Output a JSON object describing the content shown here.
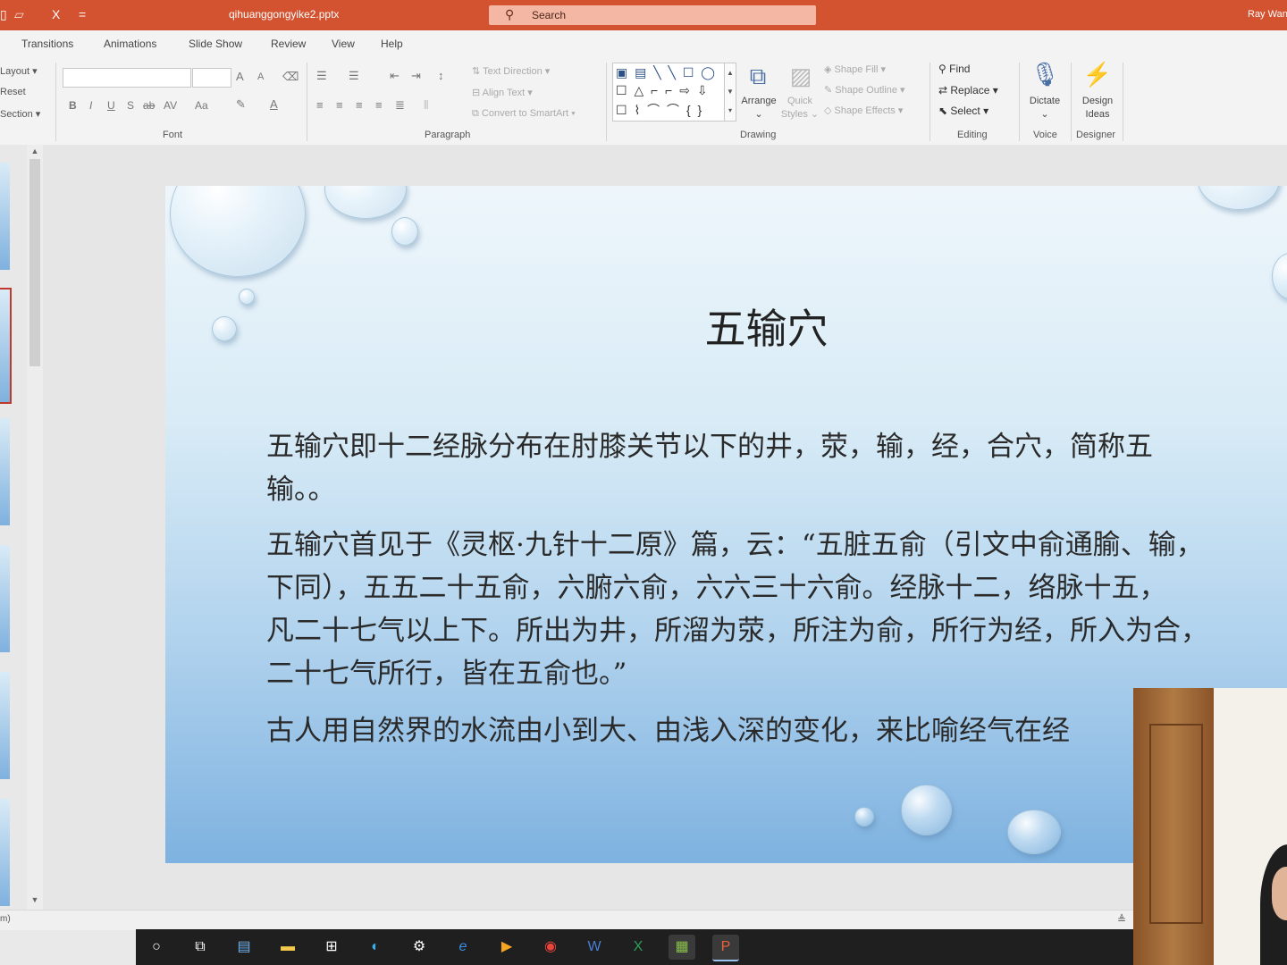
{
  "titlebar": {
    "filename": "qihuanggongyike2.pptx",
    "search_placeholder": "Search",
    "user": "Ray Wan",
    "qa_cut": "X",
    "qa_more": "="
  },
  "tabs": [
    "Transitions",
    "Animations",
    "Slide Show",
    "Review",
    "View",
    "Help"
  ],
  "ribbon": {
    "slides": {
      "layout": "Layout",
      "reset": "Reset",
      "section": "Section"
    },
    "font": {
      "label": "Font",
      "bold": "B",
      "italic": "I",
      "underline": "U",
      "shadow": "S",
      "strike": "ab",
      "spacing": "AV",
      "case": "Aa",
      "grow": "A",
      "shrink": "A"
    },
    "paragraph": {
      "label": "Paragraph",
      "text_direction": "Text Direction",
      "align_text": "Align Text",
      "convert_smartart": "Convert to SmartArt"
    },
    "drawing": {
      "label": "Drawing",
      "arrange": "Arrange",
      "quick_styles_1": "Quick",
      "quick_styles_2": "Styles",
      "shape_fill": "Shape Fill",
      "shape_outline": "Shape Outline",
      "shape_effects": "Shape Effects",
      "shapes_row1": "▣ ▤ ╲ ╲ ☐ ◯",
      "shapes_row2": "☐ △ ⌐ ⌐ ⇨ ⇩",
      "shapes_row3": "☐ ⌇ ⌒ ⌒ { }"
    },
    "editing": {
      "label": "Editing",
      "find": "Find",
      "replace": "Replace",
      "select": "Select"
    },
    "voice": {
      "label": "Voice",
      "dictate": "Dictate"
    },
    "designer": {
      "label": "Designer",
      "design_1": "Design",
      "design_2": "Ideas"
    }
  },
  "slide": {
    "title": "五输穴",
    "p1_l1": "五输穴即十二经脉分布在肘膝关节以下的井，荥，输，经，合穴，简称五",
    "p1_l2": "输。。",
    "p2_l1": "五输穴首见于《灵枢·九针十二原》篇，云：“五脏五俞（引文中俞通腧、输，",
    "p2_l2": "下同），五五二十五俞，六腑六俞，六六三十六俞。经脉十二，络脉十五，",
    "p2_l3": "凡二十七气以上下。所出为井，所溜为荥，所注为俞，所行为经，所入为合，",
    "p2_l4": "二十七气所行，皆在五俞也。”",
    "p3_l1": "古人用自然界的水流由小到大、由浅入深的变化，来比喻经气在经"
  },
  "statusbar": {
    "text": "m)"
  },
  "taskbar": {
    "icons": [
      "cortana-icon",
      "task-view-icon",
      "file-explorer-icon",
      "folder-icon",
      "store-icon",
      "edge-icon",
      "settings-icon",
      "ie-icon",
      "media-icon",
      "chrome-icon",
      "word-icon",
      "excel-icon",
      "image-icon",
      "powerpoint-icon"
    ]
  },
  "colors": {
    "titlebar": "#d35230",
    "taskbar": "#1f1f1f",
    "ribbon": "#f3f3f3"
  }
}
